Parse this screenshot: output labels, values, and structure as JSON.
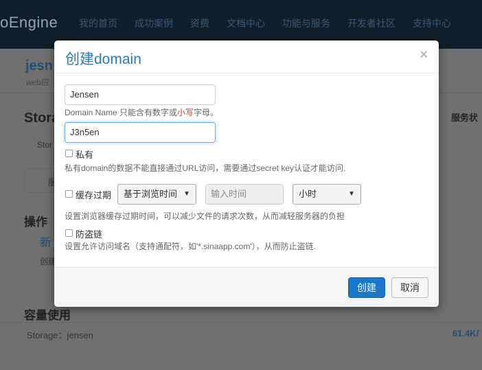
{
  "background": {
    "brand": "oEngine",
    "nav": [
      "我的首页",
      "成功案例",
      "资费",
      "文档中心",
      "功能与服务",
      "开发者社区",
      "支持中心"
    ],
    "app_name": "jesn",
    "app_sub": "web应",
    "section_storage": "Stora",
    "storage_tab": "Stor",
    "tab_short": "服",
    "service_status": "服务状",
    "ops_title": "操作",
    "new_link": "新",
    "create_short": "创建",
    "capacity_title": "容量使用",
    "storage_row_label": "Storage：jensen",
    "storage_row_value": "61.4K/"
  },
  "modal": {
    "title": "创建domain",
    "close_symbol": "×",
    "domain_name_value": "Jensen",
    "domain_help_prefix": "Domain Name 只能含有数字或",
    "domain_help_highlight": "小写",
    "domain_help_suffix": "字母。",
    "secret_value": "J3n5en",
    "private_label": "私有",
    "private_help": "私有domain的数据不能直接通过URL访问，需要通过secret key认证才能访问.",
    "cache_label": "缓存过期",
    "cache_mode_selected": "基于浏览时间",
    "cache_time_placeholder": "输入时间",
    "cache_unit_selected": "小时",
    "cache_help": "设置浏览器缓存过期时间，可以减少文件的请求次数，从而减轻服务器的负担",
    "hotlink_label": "防盗链",
    "hotlink_help": "设置允许访问域名（支持通配符，如'*.sinaapp.com'），从而防止盗链.",
    "create_button": "创建",
    "cancel_button": "取消"
  },
  "colors": {
    "title": "#2a7ab8",
    "primary_button": "#1a77c9",
    "highlight": "#c0392b"
  }
}
